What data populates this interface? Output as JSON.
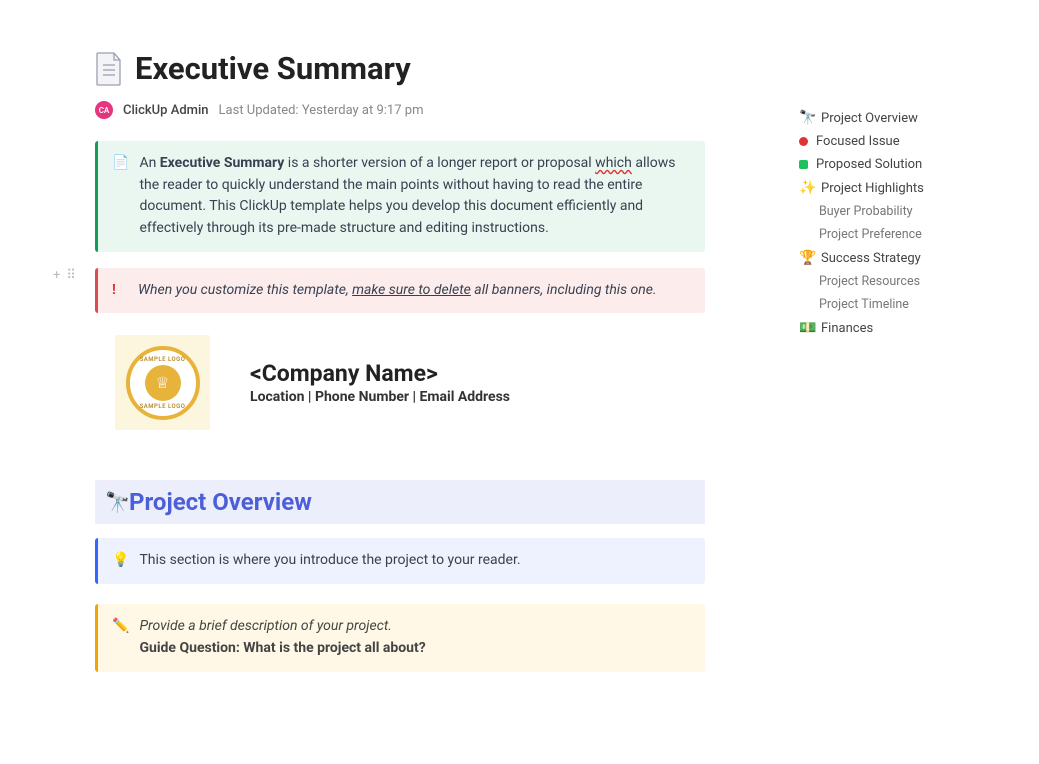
{
  "header": {
    "title": "Executive Summary",
    "avatar_initials": "CA",
    "author": "ClickUp Admin",
    "updated_label": "Last Updated:",
    "updated_value": "Yesterday at 9:17 pm"
  },
  "banners": {
    "intro_prefix": "An ",
    "intro_bold": "Executive Summary",
    "intro_mid1": " is a shorter version of a longer report or proposal ",
    "intro_which": "which",
    "intro_mid2": " allows the reader to quickly understand the main points without having to read the entire document. This ClickUp template helps you develop this document efficiently and effectively through its pre-made structure and editing instructions.",
    "warn_prefix": "When you customize this template, ",
    "warn_underline": "make sure to delete",
    "warn_suffix": " all banners, including this one.",
    "overview_tip": "This section is where you introduce the project to your reader.",
    "overview_guide_desc": "Provide a brief description of your project.",
    "overview_guide_q": "Guide Question: What is the project all about?"
  },
  "company": {
    "logo_text": "SAMPLE LOGO",
    "name": "<Company Name>",
    "subline": "Location | Phone Number | Email Address"
  },
  "section": {
    "overview_title": "Project Overview"
  },
  "outline": {
    "items": [
      {
        "icon": "🔭",
        "label": "Project Overview",
        "kind": "head"
      },
      {
        "icon": "dot-red",
        "label": "Focused Issue",
        "kind": "head"
      },
      {
        "icon": "dot-green",
        "label": "Proposed Solution",
        "kind": "head"
      },
      {
        "icon": "✨",
        "label": "Project Highlights",
        "kind": "head"
      },
      {
        "icon": "",
        "label": "Buyer Probability",
        "kind": "sub"
      },
      {
        "icon": "",
        "label": "Project Preference",
        "kind": "sub"
      },
      {
        "icon": "🏆",
        "label": "Success Strategy",
        "kind": "head"
      },
      {
        "icon": "",
        "label": "Project Resources",
        "kind": "sub"
      },
      {
        "icon": "",
        "label": "Project Timeline",
        "kind": "sub"
      },
      {
        "icon": "💵",
        "label": "Finances",
        "kind": "head"
      }
    ]
  }
}
